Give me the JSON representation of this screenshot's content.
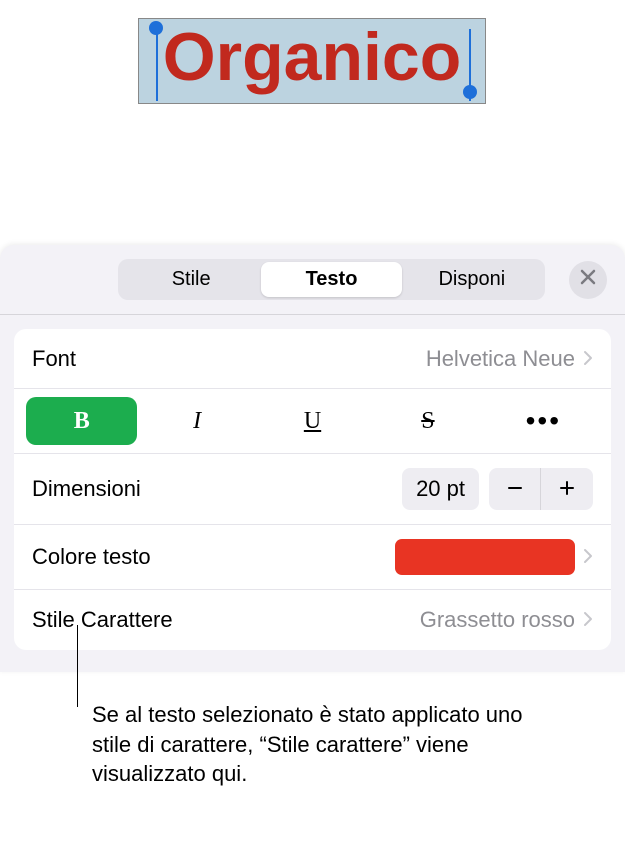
{
  "canvas": {
    "selected_text": "Organico"
  },
  "panel": {
    "tabs": [
      {
        "label": "Stile"
      },
      {
        "label": "Testo"
      },
      {
        "label": "Disponi"
      }
    ],
    "active_tab_index": 1,
    "font_row": {
      "label": "Font",
      "value": "Helvetica Neue"
    },
    "style_buttons": {
      "bold": "B",
      "italic": "I",
      "underline": "U",
      "strike": "S"
    },
    "size_row": {
      "label": "Dimensioni",
      "value": "20 pt"
    },
    "color_row": {
      "label": "Colore testo",
      "color": "#e83423"
    },
    "char_style_row": {
      "label": "Stile Carattere",
      "value": "Grassetto rosso"
    }
  },
  "callout": {
    "text": "Se al testo selezionato è stato applicato uno stile di carattere, “Stile carattere” viene visualizzato qui."
  }
}
